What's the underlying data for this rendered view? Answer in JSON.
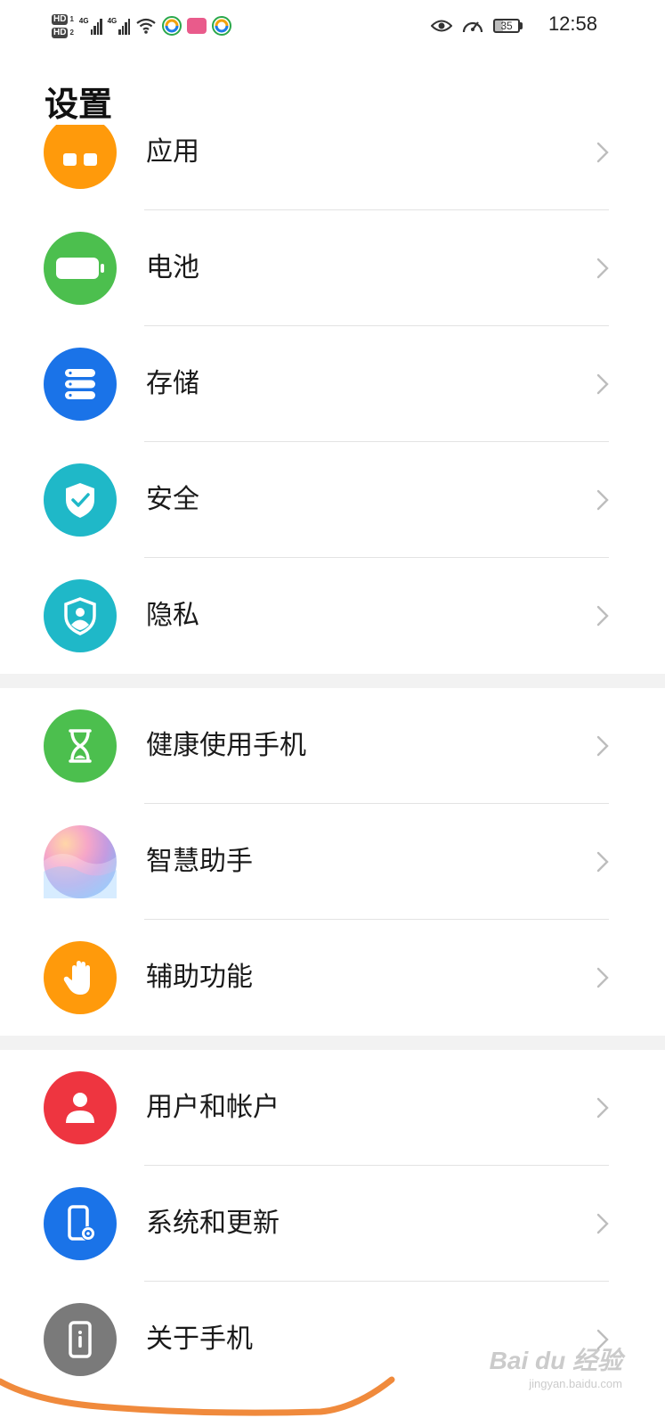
{
  "status_bar": {
    "time": "12:58",
    "battery_level": "35",
    "sim1_badge": "HD",
    "sim1_index": "1",
    "sim2_badge": "HD",
    "sim2_index": "2",
    "network1": "4G",
    "network2": "4G",
    "icons": [
      "wifi-icon",
      "app-notification-icon",
      "weibo-icon",
      "app-notification-icon",
      "eye-comfort-icon",
      "speedometer-icon",
      "battery-icon"
    ]
  },
  "page": {
    "title": "设置"
  },
  "settings": [
    {
      "label": "应用",
      "icon": "apps-icon",
      "color": "#FF9A0B"
    },
    {
      "label": "电池",
      "icon": "battery-icon",
      "color": "#4CBF4E"
    },
    {
      "label": "存储",
      "icon": "storage-icon",
      "color": "#1A73E8"
    },
    {
      "label": "安全",
      "icon": "shield-check-icon",
      "color": "#1FB8C8"
    },
    {
      "label": "隐私",
      "icon": "privacy-icon",
      "color": "#1FB8C8"
    },
    {
      "label": "健康使用手机",
      "icon": "hourglass-icon",
      "color": "#4CBF4E"
    },
    {
      "label": "智慧助手",
      "icon": "smart-assistant-icon",
      "color": "#C59BE0"
    },
    {
      "label": "辅助功能",
      "icon": "hand-icon",
      "color": "#FF9A0B"
    },
    {
      "label": "用户和帐户",
      "icon": "user-icon",
      "color": "#EE3540"
    },
    {
      "label": "系统和更新",
      "icon": "system-update-icon",
      "color": "#1A73E8"
    },
    {
      "label": "关于手机",
      "icon": "about-phone-icon",
      "color": "#7A7A7A"
    }
  ],
  "watermark": {
    "mark": "Bai du 经验",
    "site": "jingyan.baidu.com"
  },
  "colors": {
    "annotation_stroke": "#F08A3C",
    "chevron": "#BDBDBD",
    "section_gap": "#F2F2F2"
  }
}
